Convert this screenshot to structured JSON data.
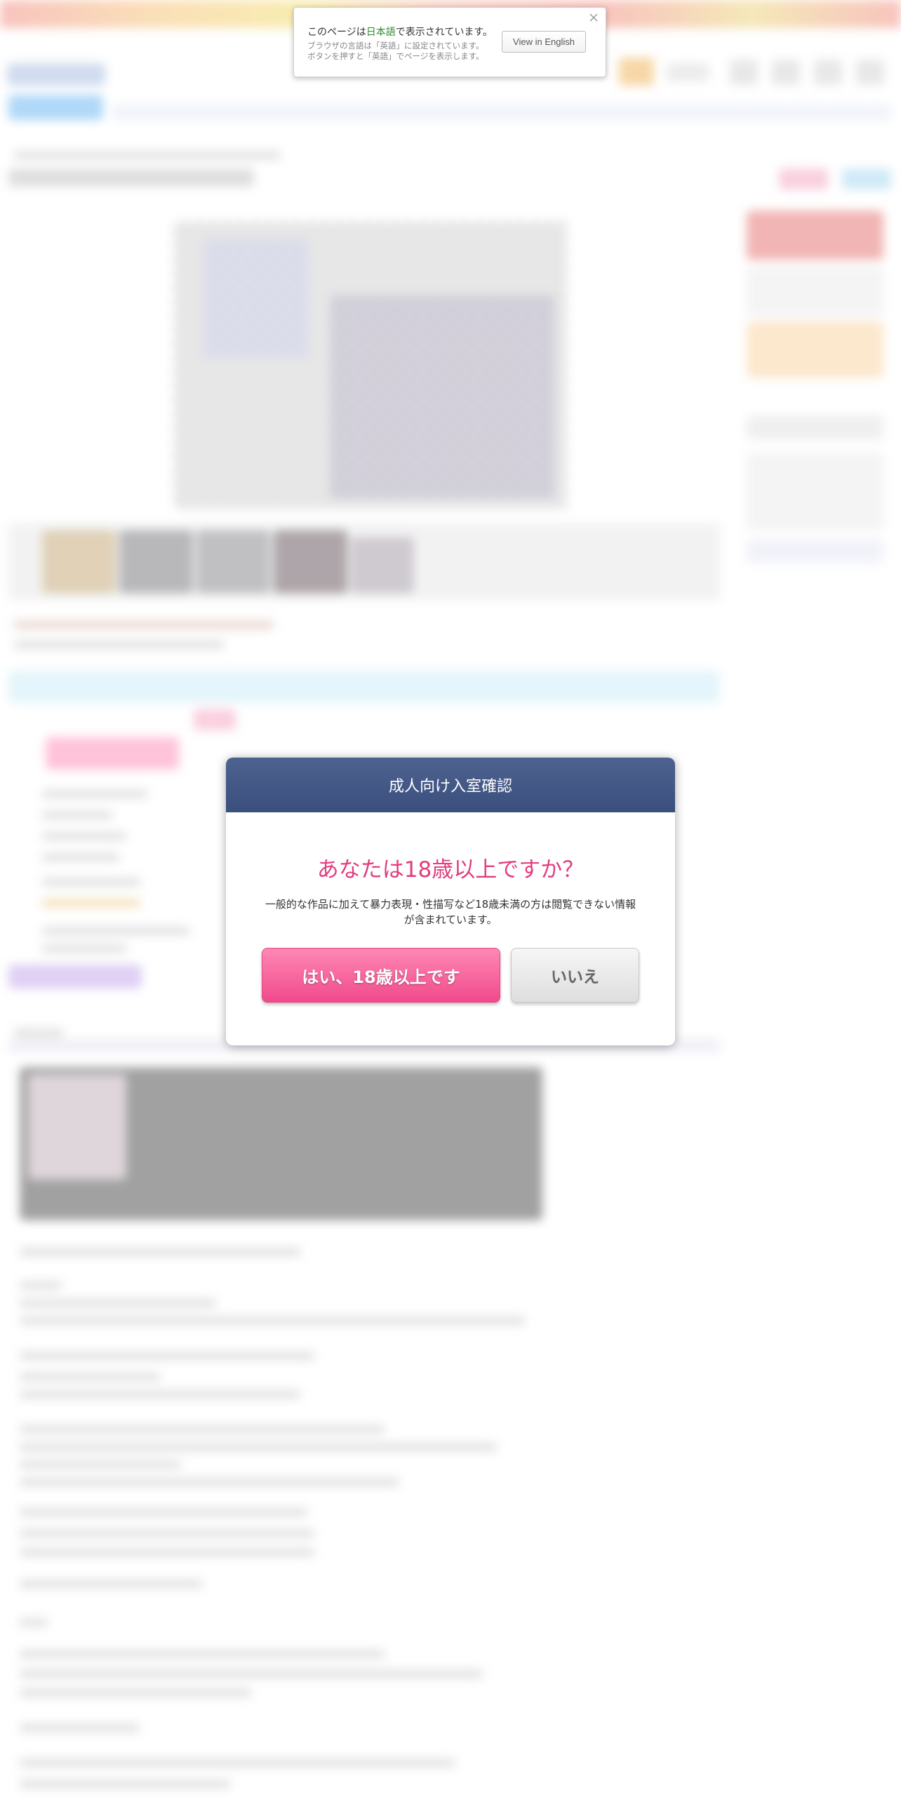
{
  "language_notice": {
    "title_prefix": "このページは",
    "title_language": "日本語",
    "title_suffix": "で表示されています。",
    "subtext_line1": "ブラウザの言語は「英語」に設定されています。",
    "subtext_line2": "ボタンを押すと「英語」でページを表示します。",
    "view_button_label": "View in English",
    "close_icon": "close-icon"
  },
  "age_modal": {
    "header_title": "成人向け入室確認",
    "question": "あなたは18歳以上ですか？",
    "description": "一般的な作品に加えて暴力表現・性描写など18歳未満の方は閲覧できない情報が含まれています。",
    "yes_button_label": "はい、18歳以上です",
    "no_button_label": "いいえ",
    "colors": {
      "header": "#3f5382",
      "question": "#e23d7f",
      "yes_button": "#f05a93",
      "no_button": "#e8e8e8"
    }
  }
}
